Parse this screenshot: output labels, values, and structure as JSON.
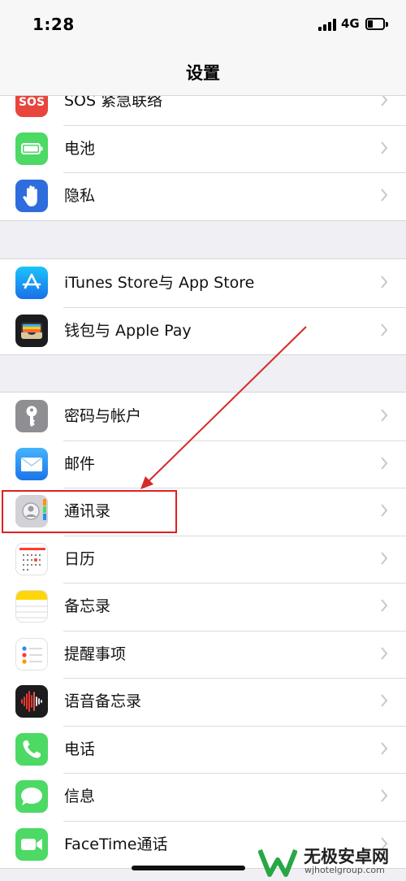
{
  "status": {
    "time": "1:28",
    "network": "4G"
  },
  "nav": {
    "title": "设置"
  },
  "groups": [
    {
      "items": [
        {
          "label": "SOS 紧急联络",
          "icon": "sos-icon",
          "icon_text": "SOS",
          "color": "#e8453c"
        },
        {
          "label": "电池",
          "icon": "battery-icon",
          "color": "#4cd964"
        },
        {
          "label": "隐私",
          "icon": "hand-icon",
          "color": "#2f6cdd"
        }
      ]
    },
    {
      "items": [
        {
          "label": "iTunes Store与 App Store",
          "icon": "app-store-icon",
          "color": "#1e8ef5"
        },
        {
          "label": "钱包与 Apple Pay",
          "icon": "wallet-icon",
          "color": "#1c1c1e"
        }
      ]
    },
    {
      "items": [
        {
          "label": "密码与帐户",
          "icon": "key-icon",
          "color": "#8e8e93"
        },
        {
          "label": "邮件",
          "icon": "mail-icon",
          "color": "#2d8cf0"
        },
        {
          "label": "通讯录",
          "icon": "contacts-icon",
          "color": "#c9c9ce"
        },
        {
          "label": "日历",
          "icon": "calendar-icon",
          "color": "#ffffff"
        },
        {
          "label": "备忘录",
          "icon": "notes-icon",
          "color": "#ffd60a"
        },
        {
          "label": "提醒事项",
          "icon": "reminders-icon",
          "color": "#ffffff"
        },
        {
          "label": "语音备忘录",
          "icon": "voice-memos-icon",
          "color": "#1c1c1e"
        },
        {
          "label": "电话",
          "icon": "phone-icon",
          "color": "#4cd964"
        },
        {
          "label": "信息",
          "icon": "messages-icon",
          "color": "#4cd964"
        },
        {
          "label": "FaceTime通话",
          "icon": "facetime-icon",
          "color": "#4cd964"
        }
      ]
    }
  ],
  "annotation": {
    "color": "#e02020"
  },
  "watermark": {
    "title": "无极安卓网",
    "url": "wjhotelgroup.com"
  }
}
